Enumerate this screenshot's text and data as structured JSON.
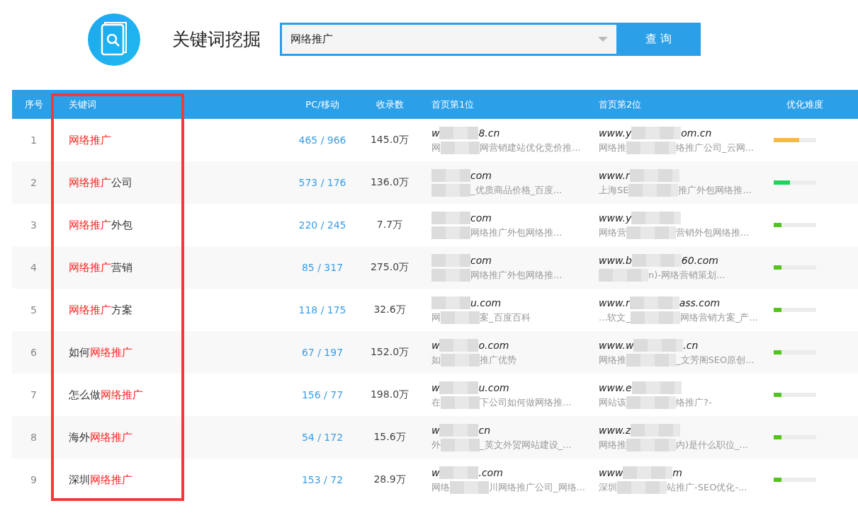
{
  "header": {
    "title": "关键词挖掘",
    "search": {
      "value": "网络推广"
    },
    "query_button": "查 询"
  },
  "table": {
    "columns": [
      "序号",
      "关键词",
      "PC/移动",
      "收录数",
      "首页第1位",
      "首页第2位",
      "优化难度"
    ],
    "rows": [
      {
        "index": "1",
        "keyword": [
          {
            "text": "网络推广",
            "highlight": true
          }
        ],
        "pc_mobile": "465 / 966",
        "indexed": "145.0万",
        "first": {
          "url_start": "w",
          "url_end": "8.cn",
          "title_start": "网",
          "title_end": "网营销建站优化竞价推..."
        },
        "second": {
          "url_start": "www.y",
          "url_end": "om.cn",
          "title_start": "网络推",
          "title_end": "络推广公司_云网..."
        },
        "level": 0.6,
        "color": "#f5b942"
      },
      {
        "index": "2",
        "keyword": [
          {
            "text": "网络推广",
            "highlight": true
          },
          {
            "text": "公司",
            "highlight": false
          }
        ],
        "pc_mobile": "573 / 176",
        "indexed": "136.0万",
        "first": {
          "url_end": "com",
          "title_end": "_优质商品价格_百度..."
        },
        "second": {
          "url_start": "www.r",
          "title_start": "上海SE",
          "title_end": "推广外包网络推..."
        },
        "level": 0.38,
        "color": "#22d35a"
      },
      {
        "index": "3",
        "keyword": [
          {
            "text": "网络推广",
            "highlight": true
          },
          {
            "text": "外包",
            "highlight": false
          }
        ],
        "pc_mobile": "220 / 245",
        "indexed": "7.7万",
        "first": {
          "url_end": "com",
          "title_end": "网络推广外包网络推..."
        },
        "second": {
          "url_start": "www.y",
          "title_start": "网络营",
          "title_end": "营销外包网络推..."
        },
        "level": 0.18,
        "color": "#52c41a"
      },
      {
        "index": "4",
        "keyword": [
          {
            "text": "网络推广",
            "highlight": true
          },
          {
            "text": "营销",
            "highlight": false
          }
        ],
        "pc_mobile": "85 / 317",
        "indexed": "275.0万",
        "first": {
          "url_end": "com",
          "title_end": "网络推广外包网络推..."
        },
        "second": {
          "url_start": "www.b",
          "url_end": "60.com",
          "title_end": "n)-网络营销策划..."
        },
        "level": 0.18,
        "color": "#52c41a"
      },
      {
        "index": "5",
        "keyword": [
          {
            "text": "网络推广",
            "highlight": true
          },
          {
            "text": "方案",
            "highlight": false
          }
        ],
        "pc_mobile": "118 / 175",
        "indexed": "32.6万",
        "first": {
          "url_end": "u.com",
          "title_start": "网",
          "title_end": "案_百度百科"
        },
        "second": {
          "url_start": "www.r",
          "url_end": "ass.com",
          "title_start": "...软文_",
          "title_end": "网络营销方案_产..."
        },
        "level": 0.18,
        "color": "#52c41a"
      },
      {
        "index": "6",
        "keyword": [
          {
            "text": "如何",
            "highlight": false
          },
          {
            "text": "网络推广",
            "highlight": true
          }
        ],
        "pc_mobile": "67 / 197",
        "indexed": "152.0万",
        "first": {
          "url_start": "w",
          "url_end": "o.com",
          "title_start": "如",
          "title_end": "推广优势"
        },
        "second": {
          "url_start": "www.w",
          "url_end": ".cn",
          "title_start": "网络推",
          "title_end": "_文芳阁SEO原创..."
        },
        "level": 0.18,
        "color": "#52c41a"
      },
      {
        "index": "7",
        "keyword": [
          {
            "text": "怎么做",
            "highlight": false
          },
          {
            "text": "网络推广",
            "highlight": true
          }
        ],
        "pc_mobile": "156 / 77",
        "indexed": "198.0万",
        "first": {
          "url_start": "w",
          "url_end": "u.com",
          "title_start": "在",
          "title_end": "下公司如何做网络推..."
        },
        "second": {
          "url_start": "www.e",
          "title_start": "网站该",
          "title_end": "络推广?-"
        },
        "level": 0.18,
        "color": "#52c41a"
      },
      {
        "index": "8",
        "keyword": [
          {
            "text": "海外",
            "highlight": false
          },
          {
            "text": "网络推广",
            "highlight": true
          }
        ],
        "pc_mobile": "54 / 172",
        "indexed": "15.6万",
        "first": {
          "url_start": "w",
          "url_end": "cn",
          "title_start": "外",
          "title_end": "_英文外贸网站建设_..."
        },
        "second": {
          "url_start": "www.z",
          "title_start": "网络推",
          "title_end": "内)是什么职位_..."
        },
        "level": 0.18,
        "color": "#52c41a"
      },
      {
        "index": "9",
        "keyword": [
          {
            "text": "深圳",
            "highlight": false
          },
          {
            "text": "网络推广",
            "highlight": true
          }
        ],
        "pc_mobile": "153 / 72",
        "indexed": "28.9万",
        "first": {
          "url_start": "w",
          "url_end": ".com",
          "title_start": "网络",
          "title_end": "川网络推广公司_网络..."
        },
        "second": {
          "url_start": "www",
          "url_end": "m",
          "title_start": "深圳",
          "title_end": "站推广-SEO优化-..."
        },
        "level": 0.18,
        "color": "#52c41a"
      }
    ]
  }
}
